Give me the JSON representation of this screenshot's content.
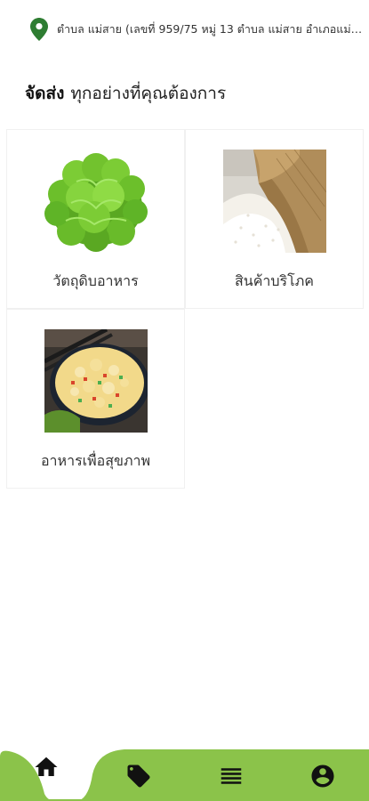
{
  "location": {
    "icon": "location-pin-icon",
    "address": "ตำบล แม่สาย (เลขที่ 959/75 หมู่ 13 ตำบล แม่สาย อำเภอแม่สาย..."
  },
  "heading": {
    "bold": "จัดส่ง",
    "rest": "ทุกอย่างที่คุณต้องการ"
  },
  "categories": [
    {
      "label": "วัตถุดิบอาหาร",
      "image": "lettuce-image"
    },
    {
      "label": "สินค้าบริโภค",
      "image": "rice-sack-image"
    },
    {
      "label": "อาหารเพื่อสุขภาพ",
      "image": "fried-rice-image"
    }
  ],
  "bottom_nav": {
    "items": [
      {
        "icon": "home-icon",
        "active": true
      },
      {
        "icon": "tag-icon",
        "active": false
      },
      {
        "icon": "list-icon",
        "active": false
      },
      {
        "icon": "account-icon",
        "active": false
      }
    ]
  },
  "colors": {
    "accent": "#8bc34a",
    "pin": "#2e7d32",
    "icon": "#111111"
  }
}
